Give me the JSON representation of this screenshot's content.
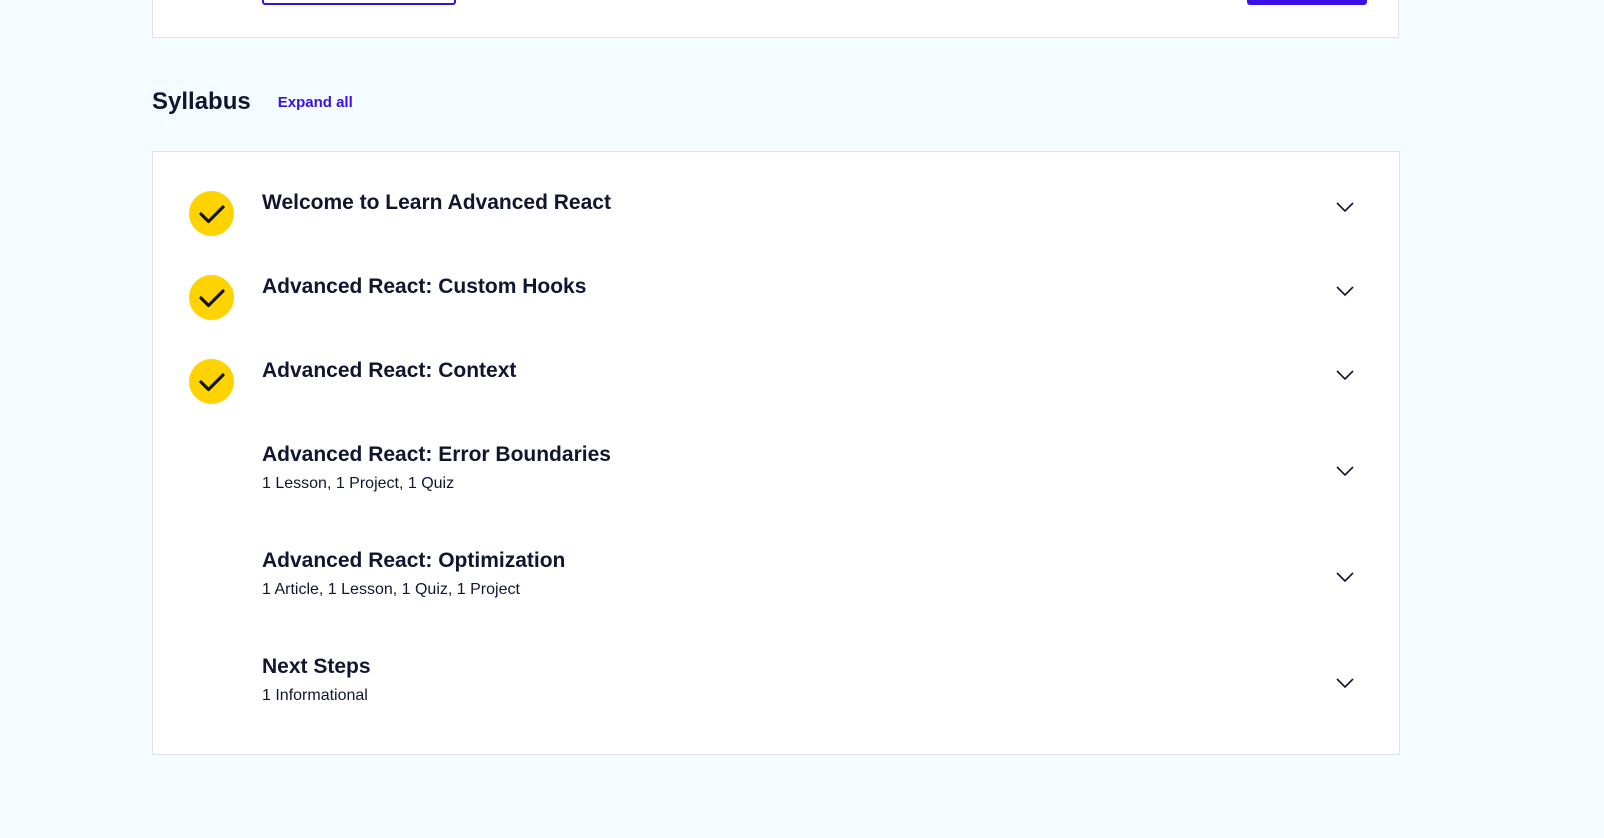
{
  "syllabus": {
    "title": "Syllabus",
    "expand_all_label": "Expand all",
    "modules": [
      {
        "title": "Welcome to Learn Advanced React",
        "subtitle": "",
        "completed": true
      },
      {
        "title": "Advanced React: Custom Hooks",
        "subtitle": "",
        "completed": true
      },
      {
        "title": "Advanced React: Context",
        "subtitle": "",
        "completed": true
      },
      {
        "title": "Advanced React: Error Boundaries",
        "subtitle": "1 Lesson, 1 Project, 1 Quiz",
        "completed": false
      },
      {
        "title": "Advanced React: Optimization",
        "subtitle": "1 Article, 1 Lesson, 1 Quiz, 1 Project",
        "completed": false
      },
      {
        "title": "Next Steps",
        "subtitle": "1 Informational",
        "completed": false
      }
    ]
  },
  "icons": {
    "completed": "check-icon",
    "expand": "chevron-down-icon"
  },
  "colors": {
    "accent": "#3a10e5",
    "check_badge": "#ffd300",
    "text": "#10162f",
    "page_background": "#f5fcff",
    "card_border": "#dfe3ea"
  }
}
